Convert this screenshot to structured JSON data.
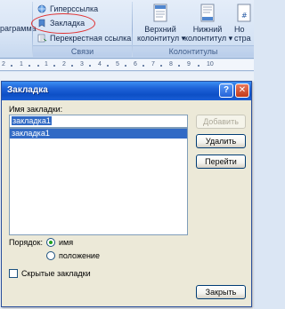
{
  "ribbon": {
    "left_fragment": "раграмма",
    "links_group": {
      "hyperlink": "Гиперссылка",
      "bookmark": "Закладка",
      "cross_reference": "Перекрестная ссылка",
      "label": "Связи"
    },
    "header_footer_group": {
      "header_line1": "Верхний",
      "header_line2": "колонтитул",
      "footer_line1": "Нижний",
      "footer_line2": "колонтитул",
      "page_number_line1": "Но",
      "page_number_line2": "стра",
      "label": "Колонтитулы"
    },
    "colors": {
      "annotation_ellipse": "#e03030"
    }
  },
  "ruler": {
    "numbers": [
      "2",
      "1",
      "1",
      "2",
      "3",
      "4",
      "5",
      "6",
      "7",
      "8",
      "9",
      "10"
    ]
  },
  "dialog": {
    "title": "Закладка",
    "help_glyph": "?",
    "close_glyph": "✕",
    "name_label": "Имя закладки:",
    "name_value": "закладка1",
    "list_items": [
      "закладка1"
    ],
    "buttons": {
      "add": "Добавить",
      "delete": "Удалить",
      "goto": "Перейти",
      "close": "Закрыть"
    },
    "sort_label": "Порядок:",
    "sort_options": [
      {
        "label": "имя",
        "selected": true
      },
      {
        "label": "положение",
        "selected": false
      }
    ],
    "hidden_bookmarks_label": "Скрытые закладки",
    "hidden_bookmarks_checked": false
  }
}
